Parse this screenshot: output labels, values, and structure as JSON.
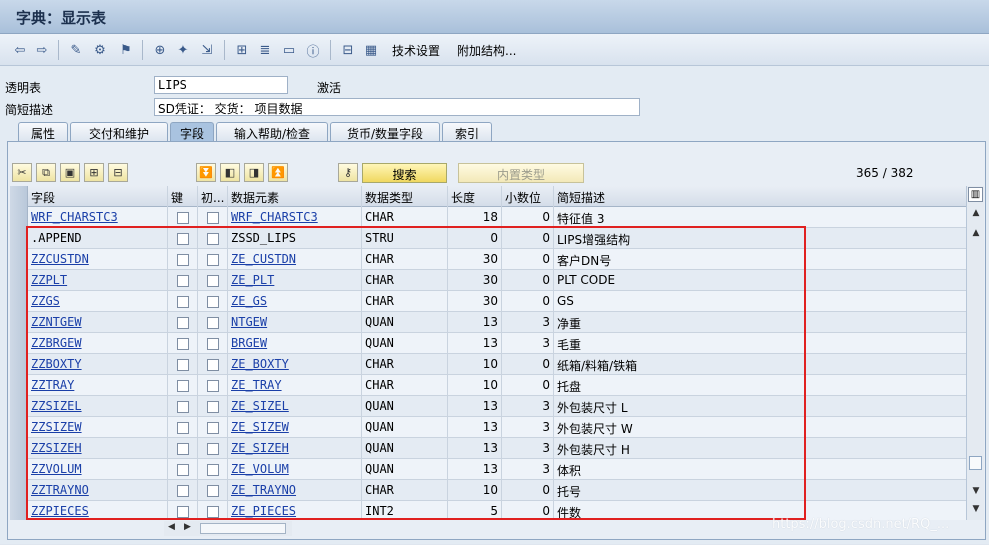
{
  "window": {
    "title": "字典：显示表"
  },
  "toolbar": {
    "tech_settings": "技术设置",
    "append_structure": "附加结构..."
  },
  "form": {
    "transparent_table_label": "透明表",
    "table_name": "LIPS",
    "status": "激活",
    "short_desc_label": "简短描述",
    "short_desc_value": "SD凭证：  交货：  项目数据"
  },
  "tabs": [
    {
      "label": "属性"
    },
    {
      "label": "交付和维护"
    },
    {
      "label": "字段"
    },
    {
      "label": "输入帮助/检查"
    },
    {
      "label": "货币/数量字段"
    },
    {
      "label": "索引"
    }
  ],
  "actions": {
    "search": "搜索",
    "builtin_type": "内置类型",
    "counter": "365  /  382"
  },
  "grid": {
    "columns": [
      "字段",
      "键",
      "初...",
      "数据元素",
      "数据类型",
      "长度",
      "小数位",
      "简短描述"
    ],
    "rows": [
      {
        "field": "WRF_CHARSTC3",
        "data_element": "WRF_CHARSTC3",
        "type": "CHAR",
        "length": "18",
        "decimals": "0",
        "desc": "特征值 3",
        "field_link": true,
        "de_link": true
      },
      {
        "field": ".APPEND",
        "data_element": "ZSSD_LIPS",
        "type": "STRU",
        "length": "0",
        "decimals": "0",
        "desc": "LIPS增强结构",
        "field_link": false,
        "de_link": false
      },
      {
        "field": "ZZCUSTDN",
        "data_element": "ZE_CUSTDN",
        "type": "CHAR",
        "length": "30",
        "decimals": "0",
        "desc": "客户DN号",
        "field_link": true,
        "de_link": true
      },
      {
        "field": "ZZPLT",
        "data_element": "ZE_PLT",
        "type": "CHAR",
        "length": "30",
        "decimals": "0",
        "desc": "PLT CODE",
        "field_link": true,
        "de_link": true
      },
      {
        "field": "ZZGS",
        "data_element": "ZE_GS",
        "type": "CHAR",
        "length": "30",
        "decimals": "0",
        "desc": "GS",
        "field_link": true,
        "de_link": true
      },
      {
        "field": "ZZNTGEW",
        "data_element": "NTGEW",
        "type": "QUAN",
        "length": "13",
        "decimals": "3",
        "desc": "净重",
        "field_link": true,
        "de_link": true
      },
      {
        "field": "ZZBRGEW",
        "data_element": "BRGEW",
        "type": "QUAN",
        "length": "13",
        "decimals": "3",
        "desc": "毛重",
        "field_link": true,
        "de_link": true
      },
      {
        "field": "ZZBOXTY",
        "data_element": "ZE_BOXTY",
        "type": "CHAR",
        "length": "10",
        "decimals": "0",
        "desc": "纸箱/料箱/铁箱",
        "field_link": true,
        "de_link": true
      },
      {
        "field": "ZZTRAY",
        "data_element": "ZE_TRAY",
        "type": "CHAR",
        "length": "10",
        "decimals": "0",
        "desc": "托盘",
        "field_link": true,
        "de_link": true
      },
      {
        "field": "ZZSIZEL",
        "data_element": "ZE_SIZEL",
        "type": "QUAN",
        "length": "13",
        "decimals": "3",
        "desc": "外包装尺寸 L",
        "field_link": true,
        "de_link": true
      },
      {
        "field": "ZZSIZEW",
        "data_element": "ZE_SIZEW",
        "type": "QUAN",
        "length": "13",
        "decimals": "3",
        "desc": "外包装尺寸 W",
        "field_link": true,
        "de_link": true
      },
      {
        "field": "ZZSIZEH",
        "data_element": "ZE_SIZEH",
        "type": "QUAN",
        "length": "13",
        "decimals": "3",
        "desc": "外包装尺寸 H",
        "field_link": true,
        "de_link": true
      },
      {
        "field": "ZZVOLUM",
        "data_element": "ZE_VOLUM",
        "type": "QUAN",
        "length": "13",
        "decimals": "3",
        "desc": "体积",
        "field_link": true,
        "de_link": true
      },
      {
        "field": "ZZTRAYNO",
        "data_element": "ZE_TRAYNO",
        "type": "CHAR",
        "length": "10",
        "decimals": "0",
        "desc": "托号",
        "field_link": true,
        "de_link": true
      },
      {
        "field": "ZZPIECES",
        "data_element": "ZE_PIECES",
        "type": "INT2",
        "length": "5",
        "decimals": "0",
        "desc": "件数",
        "field_link": true,
        "de_link": true
      }
    ]
  },
  "watermark": "https://blog.csdn.net/RQ_...",
  "colors": {
    "highlight_border": "#e02020",
    "link": "#1a3fa8"
  }
}
